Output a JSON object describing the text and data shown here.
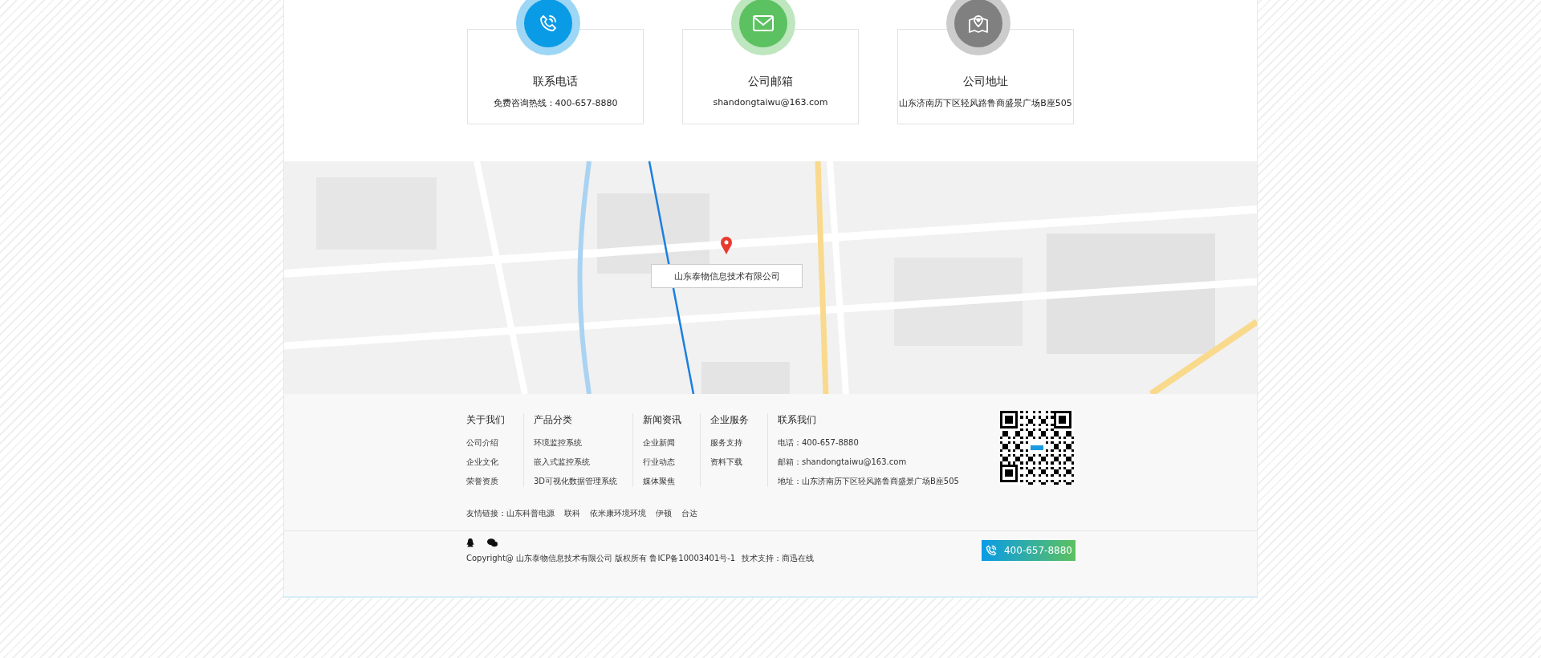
{
  "contact_cards": [
    {
      "kind": "phone",
      "color": "#0a9be6",
      "title": "联系电话",
      "text": "免费咨询热线：400-657-8880"
    },
    {
      "kind": "email",
      "color": "#5cc160",
      "title": "公司邮箱",
      "text": "shandongtaiwu@163.com"
    },
    {
      "kind": "address",
      "color": "#808080",
      "title": "公司地址",
      "text": "山东济南历下区轻风路鲁商盛景广场B座505"
    }
  ],
  "map": {
    "kind": "picture",
    "marker_label": "山东泰物信息技术有限公司"
  },
  "footer": {
    "columns": [
      {
        "heading": "关于我们",
        "links": [
          "公司介绍",
          "企业文化",
          "荣誉资质"
        ]
      },
      {
        "heading": "产品分类",
        "links": [
          "环境监控系统",
          "嵌入式监控系统",
          "3D可视化数据管理系统"
        ]
      },
      {
        "heading": "新闻资讯",
        "links": [
          "企业新闻",
          "行业动态",
          "媒体聚焦"
        ]
      },
      {
        "heading": "企业服务",
        "links": [
          "服务支持",
          "资料下载"
        ]
      }
    ],
    "contact": {
      "heading": "联系我们",
      "lines": [
        "电话：400-657-8880",
        "邮箱：shandongtaiwu@163.com",
        "地址：山东济南历下区轻风路鲁商盛景广场B座505"
      ]
    },
    "friend_links": {
      "label": "友情链接：",
      "links": [
        "山东科普电源",
        "联科",
        "依米康环境环境",
        "伊顿",
        "台达"
      ]
    },
    "copyright": "Copyright@ 山东泰物信息技术有限公司 版权所有 鲁ICP备10003401号-1",
    "tech_support": "技术支持：商迅在线",
    "phone_button": "400-657-8880"
  }
}
